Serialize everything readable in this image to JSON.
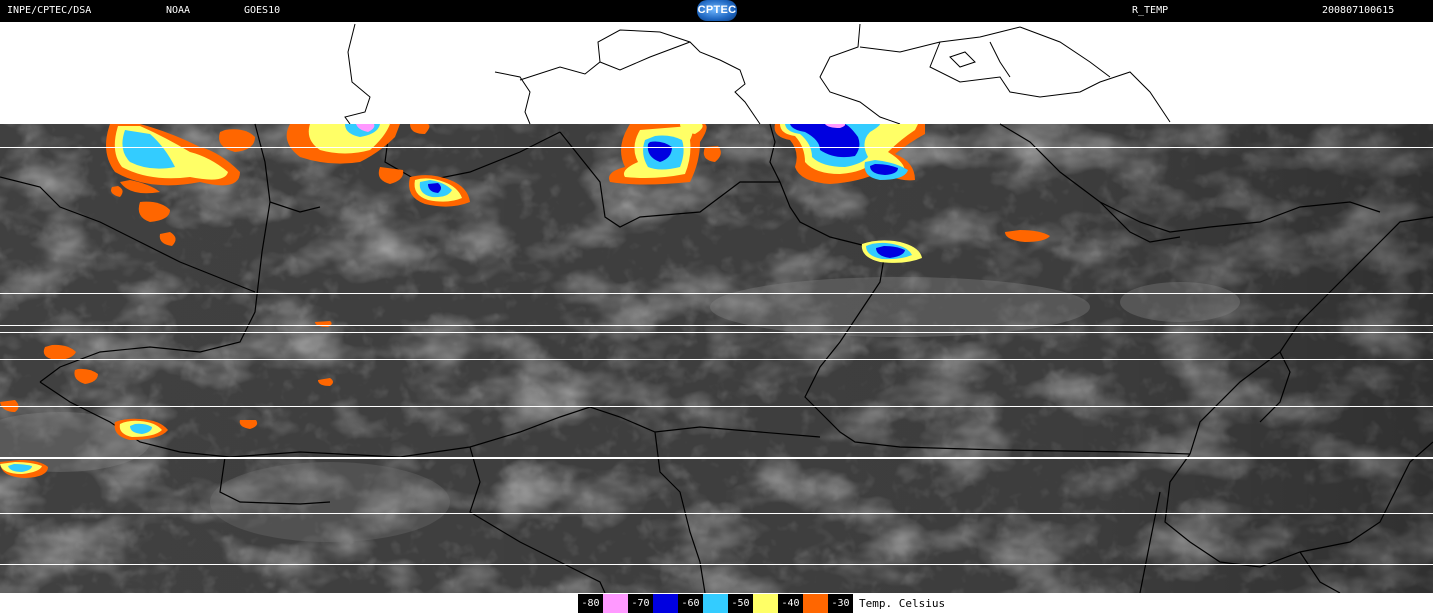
{
  "header": {
    "org": "INPE/CPTEC/DSA",
    "agency": "NOAA",
    "satellite": "GOES10",
    "product": "R_TEMP",
    "datetime": "200807100615",
    "logo_text": "CPTEC"
  },
  "legend": {
    "items": [
      {
        "label": "-80",
        "color": "#ff99ff"
      },
      {
        "label": "-70",
        "color": "#0000e0"
      },
      {
        "label": "-60",
        "color": "#33ccff"
      },
      {
        "label": "-50",
        "color": "#ffff66"
      },
      {
        "label": "-40",
        "color": "#ff6600"
      },
      {
        "label": "-30",
        "color": null
      }
    ],
    "unit_label": "Temp. Celsius"
  },
  "colors": {
    "background": "#000000",
    "no_data": "#ffffff",
    "cloud_base": "#3c3c3c",
    "borders": "#000000"
  }
}
